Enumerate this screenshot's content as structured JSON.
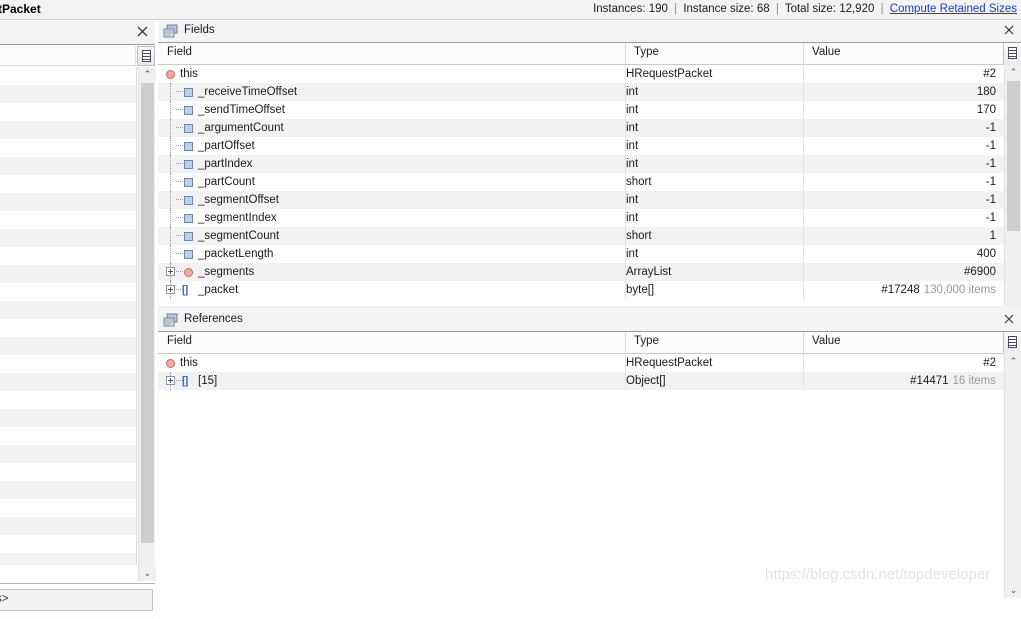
{
  "titlebar": {
    "title": "tPacket",
    "stats": {
      "instances_label": "Instances:",
      "instances_value": "190",
      "instance_size_label": "Instance size:",
      "instance_size_value": "68",
      "total_size_label": "Total size:",
      "total_size_value": "12,920",
      "link": "Compute Retained Sizes",
      "separator": "|"
    }
  },
  "left_panel": {
    "close_label": "✕",
    "grid_icon": "grid-icon",
    "scroll_up": "⌃",
    "scroll_down": "⌄",
    "footer_text": "s>"
  },
  "fields_panel": {
    "title": "Fields",
    "close_label": "✕",
    "columns": [
      "Field",
      "Type",
      "Value"
    ],
    "scroll_up": "⌃",
    "scroll_down": "⌄",
    "rows": [
      {
        "field": "this",
        "type": "HRequestPacket",
        "value": "#2",
        "extra": "",
        "icon": "ball",
        "indent": 0,
        "expander": false
      },
      {
        "field": "_receiveTimeOffset",
        "type": "int",
        "value": "180",
        "extra": "",
        "icon": "square",
        "indent": 1,
        "expander": false
      },
      {
        "field": "_sendTimeOffset",
        "type": "int",
        "value": "170",
        "extra": "",
        "icon": "square",
        "indent": 1,
        "expander": false
      },
      {
        "field": "_argumentCount",
        "type": "int",
        "value": "-1",
        "extra": "",
        "icon": "square",
        "indent": 1,
        "expander": false
      },
      {
        "field": "_partOffset",
        "type": "int",
        "value": "-1",
        "extra": "",
        "icon": "square",
        "indent": 1,
        "expander": false
      },
      {
        "field": "_partIndex",
        "type": "int",
        "value": "-1",
        "extra": "",
        "icon": "square",
        "indent": 1,
        "expander": false
      },
      {
        "field": "_partCount",
        "type": "short",
        "value": "-1",
        "extra": "",
        "icon": "square",
        "indent": 1,
        "expander": false
      },
      {
        "field": "_segmentOffset",
        "type": "int",
        "value": "-1",
        "extra": "",
        "icon": "square",
        "indent": 1,
        "expander": false
      },
      {
        "field": "_segmentIndex",
        "type": "int",
        "value": "-1",
        "extra": "",
        "icon": "square",
        "indent": 1,
        "expander": false
      },
      {
        "field": "_segmentCount",
        "type": "short",
        "value": "1",
        "extra": "",
        "icon": "square",
        "indent": 1,
        "expander": false
      },
      {
        "field": "_packetLength",
        "type": "int",
        "value": "400",
        "extra": "",
        "icon": "square",
        "indent": 1,
        "expander": false
      },
      {
        "field": "_segments",
        "type": "ArrayList",
        "value": "#6900",
        "extra": "",
        "icon": "ball",
        "indent": 1,
        "expander": true
      },
      {
        "field": "_packet",
        "type": "byte[]",
        "value": "#17248",
        "extra": "130,000 items",
        "icon": "array",
        "indent": 1,
        "expander": true
      }
    ]
  },
  "references_panel": {
    "title": "References",
    "close_label": "✕",
    "columns": [
      "Field",
      "Type",
      "Value"
    ],
    "scroll_up": "⌃",
    "scroll_down": "⌄",
    "rows": [
      {
        "field": "this",
        "type": "HRequestPacket",
        "value": "#2",
        "extra": "",
        "icon": "ball",
        "indent": 0,
        "expander": false
      },
      {
        "field": "[15]",
        "type": "Object[]",
        "value": "#14471",
        "extra": "16 items",
        "icon": "array",
        "indent": 1,
        "expander": true
      }
    ]
  },
  "watermark": "https://blog.csdn.net/topdeveloper",
  "colors": {
    "link": "#1b3fbe",
    "row_alt": "#f2f2f2",
    "panel_header": "#f3f3f3",
    "ball_icon": "#f0a9a3",
    "square_icon": "#bcd2ea",
    "array_icon": "#2f6fd0",
    "muted_text": "#9a9a9a"
  }
}
